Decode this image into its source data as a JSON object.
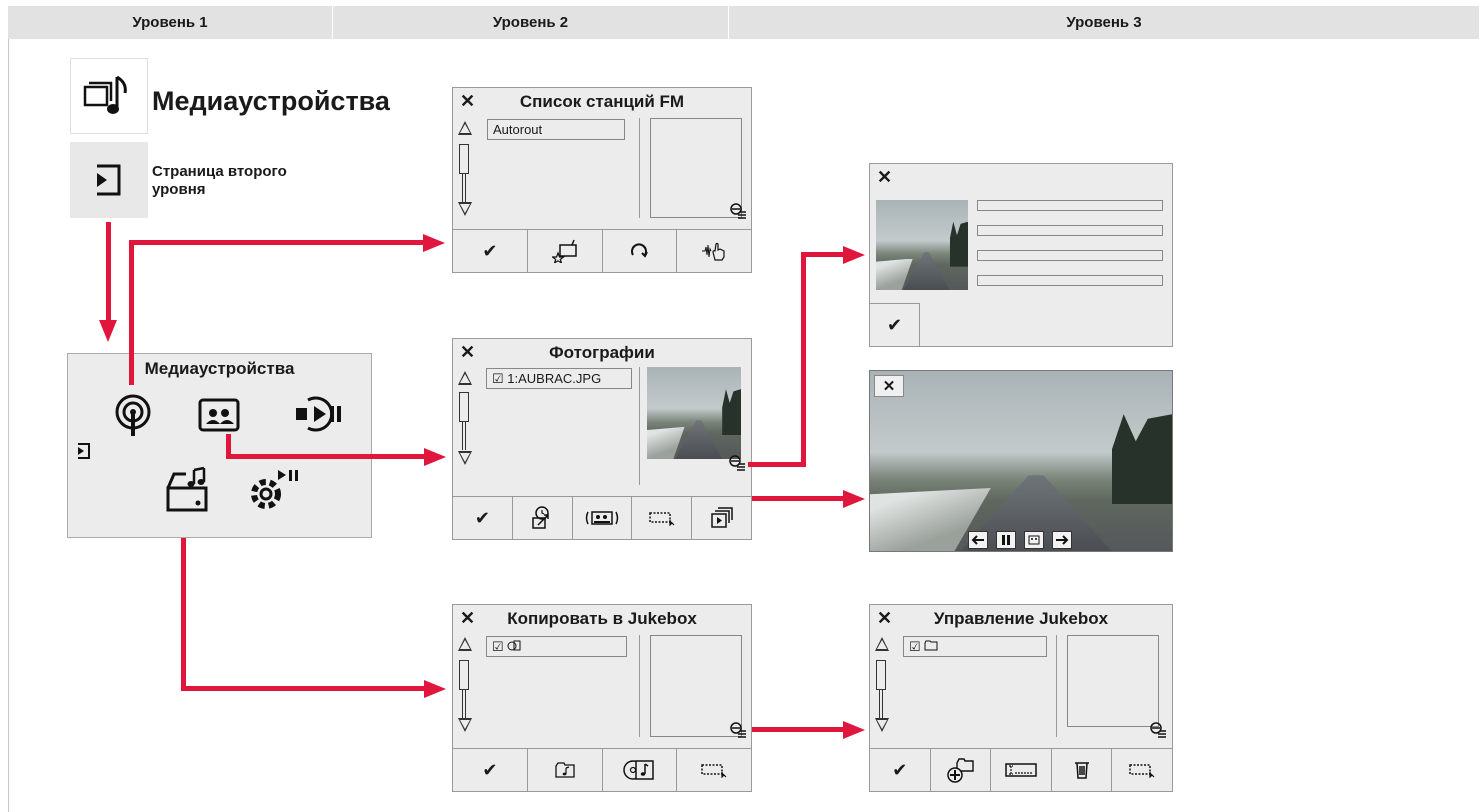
{
  "headers": [
    "Уровень 1",
    "Уровень 2",
    "Уровень 3"
  ],
  "level1": {
    "title": "Медиаустройства",
    "subtitle": "Страница второго уровня",
    "menu_title": "Медиаустройства"
  },
  "fm_panel": {
    "title": "Список станций FM",
    "item": "Autorout"
  },
  "photos_panel": {
    "title": "Фотографии",
    "item": "1:AUBRAC.JPG"
  },
  "copy_panel": {
    "title": "Копировать в Jukebox"
  },
  "manage_panel": {
    "title": "Управление Jukebox"
  },
  "symbols": {
    "close": "✕",
    "check": "✔",
    "checkbox": "☑"
  },
  "colors": {
    "arrow": "#e0163c",
    "header_bg": "#e2e2e2",
    "panel_bg": "#ececec"
  }
}
